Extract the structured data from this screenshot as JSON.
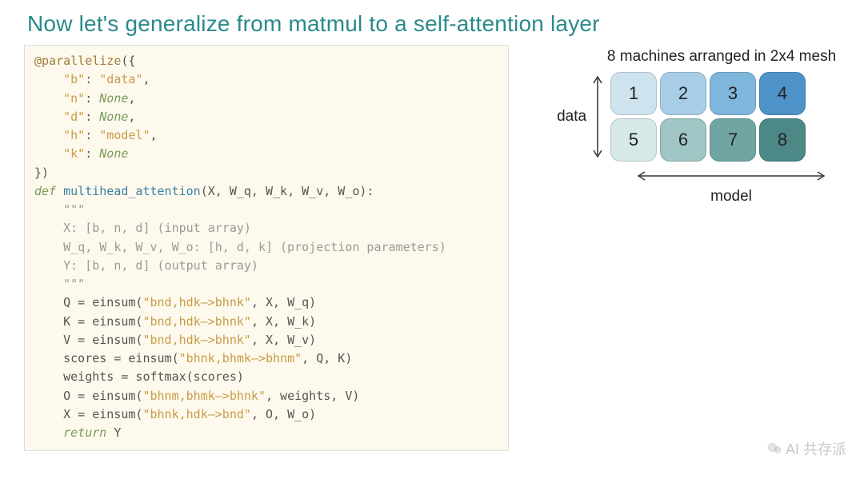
{
  "title": "Now let's generalize from matmul to a self-attention layer",
  "code": {
    "decorator": "@parallelize",
    "map": {
      "b": "\"data\"",
      "n": "None",
      "d": "None",
      "h": "\"model\"",
      "k": "None"
    },
    "def_kw": "def",
    "fn_name": "multihead_attention",
    "params": "(X, W_q, W_k, W_v, W_o):",
    "docq": "\"\"\"",
    "doc1": "X: [b, n, d] (input array)",
    "doc2": "W_q, W_k, W_v, W_o: [h, d, k] (projection parameters)",
    "doc3": "Y: [b, n, d] (output array)",
    "l_q": "Q = einsum(\"bnd,hdk—>bhnk\", X, W_q)",
    "l_k": "K = einsum(\"bnd,hdk—>bhnk\", X, W_k)",
    "l_v": "V = einsum(\"bnd,hdk—>bhnk\", X, W_v)",
    "l_sc": "scores = einsum(\"bhnk,bhmk—>bhnm\", Q, K)",
    "l_w": "weights = softmax(scores)",
    "l_o": "O = einsum(\"bhnm,bhmk—>bhnk\", weights, V)",
    "l_x": "X = einsum(\"bhnk,hdk—>bnd\", O, W_o)",
    "ret_kw": "return",
    "ret_val": "Y"
  },
  "mesh": {
    "title": "8 machines arranged in 2x4 mesh",
    "data_label": "data",
    "model_label": "model",
    "cells": [
      {
        "n": "1",
        "fill": "#cfe3ef"
      },
      {
        "n": "2",
        "fill": "#a8cde6"
      },
      {
        "n": "3",
        "fill": "#7fb6dc"
      },
      {
        "n": "4",
        "fill": "#4e93c8"
      },
      {
        "n": "5",
        "fill": "#d6e8e8"
      },
      {
        "n": "6",
        "fill": "#9fc6c4"
      },
      {
        "n": "7",
        "fill": "#6fa6a4"
      },
      {
        "n": "8",
        "fill": "#4c8886"
      }
    ]
  },
  "watermark": "AI 共存派"
}
